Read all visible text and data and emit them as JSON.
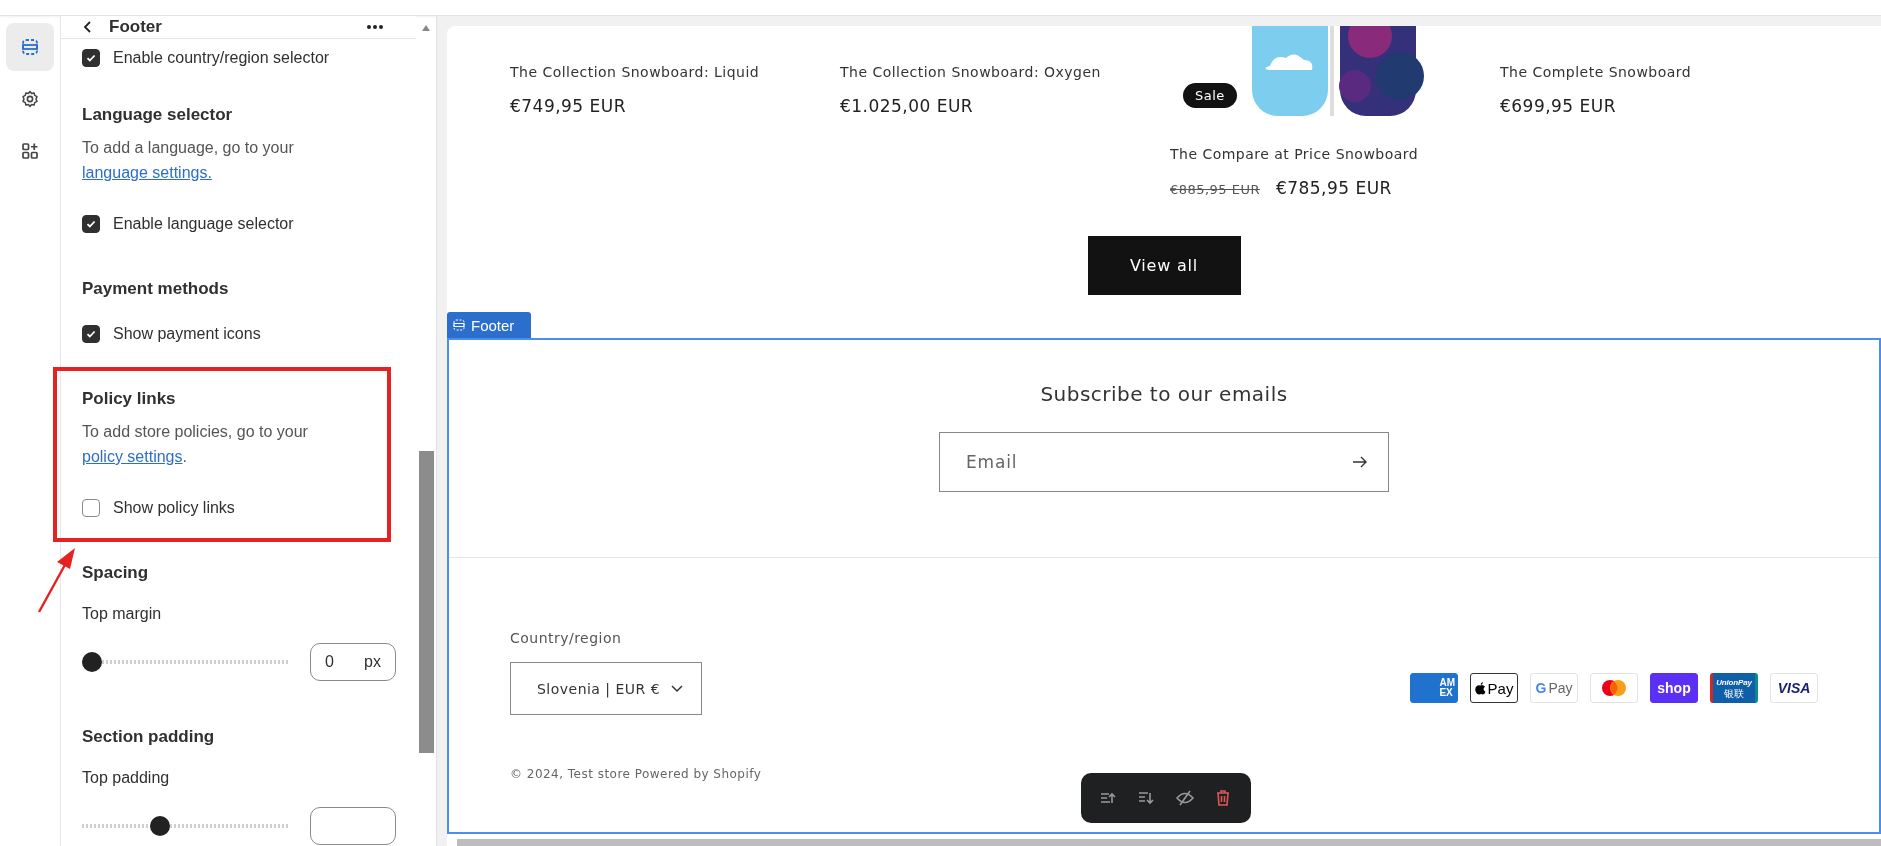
{
  "rail": [
    {
      "kind": "sections",
      "selected": true
    },
    {
      "kind": "settings",
      "selected": false
    },
    {
      "kind": "apps",
      "selected": false
    }
  ],
  "panel": {
    "title": "Footer",
    "clipped_item": {
      "label": "Enable country/region selector",
      "checked": true
    },
    "groups": [
      {
        "heading": "Language selector",
        "description": "To add a language, go to your",
        "link": "language settings.",
        "checkbox": {
          "label": "Enable language selector",
          "checked": true
        },
        "highlighted": false
      },
      {
        "heading": "Payment methods",
        "checkbox": {
          "label": "Show payment icons",
          "checked": true
        },
        "highlighted": false
      },
      {
        "heading": "Policy links",
        "description": "To add store policies, go to your",
        "link": "policy settings",
        "suffix": ".",
        "checkbox": {
          "label": "Show policy links",
          "checked": false
        },
        "highlighted": true
      }
    ],
    "spacing": {
      "heading": "Spacing",
      "label": "Top margin",
      "level": 0,
      "value": "0",
      "unit": "px"
    },
    "padding": {
      "heading": "Section padding",
      "label": "Top padding",
      "level": 0.36
    }
  },
  "products": [
    {
      "title": "The Collection Snowboard: Liquid",
      "price": "€749,95 EUR"
    },
    {
      "title": "The Collection Snowboard: Oxygen",
      "price": "€1.025,00 EUR"
    },
    {
      "title": "The Compare at Price Snowboard",
      "compare_price": "€885,95 EUR",
      "price": "€785,95 EUR",
      "badge": "Sale"
    },
    {
      "title": "The Complete Snowboard",
      "price": "€699,95 EUR"
    }
  ],
  "view_all": "View all",
  "footer": {
    "tag": "Footer",
    "subscribe_heading": "Subscribe to our emails",
    "email_placeholder": "Email",
    "country_label": "Country/region",
    "country_value": "Slovenia | EUR €",
    "payment_icons": [
      {
        "kind": "amex",
        "label": "AM",
        "label2": "EX"
      },
      {
        "kind": "applepay",
        "label": "Pay"
      },
      {
        "kind": "gpay",
        "label": "G",
        "label2": "Pay"
      },
      {
        "kind": "mastercard"
      },
      {
        "kind": "shop",
        "label": "shop"
      },
      {
        "kind": "unionpay",
        "label": "UnionPay",
        "label2": "银联"
      },
      {
        "kind": "visa",
        "label": "VISA"
      }
    ],
    "copyright": "© 2024, Test store",
    "powered_by": "Powered by Shopify"
  },
  "toolbar": [
    {
      "kind": "move-up"
    },
    {
      "kind": "move-down"
    },
    {
      "kind": "hide"
    },
    {
      "kind": "delete"
    }
  ]
}
